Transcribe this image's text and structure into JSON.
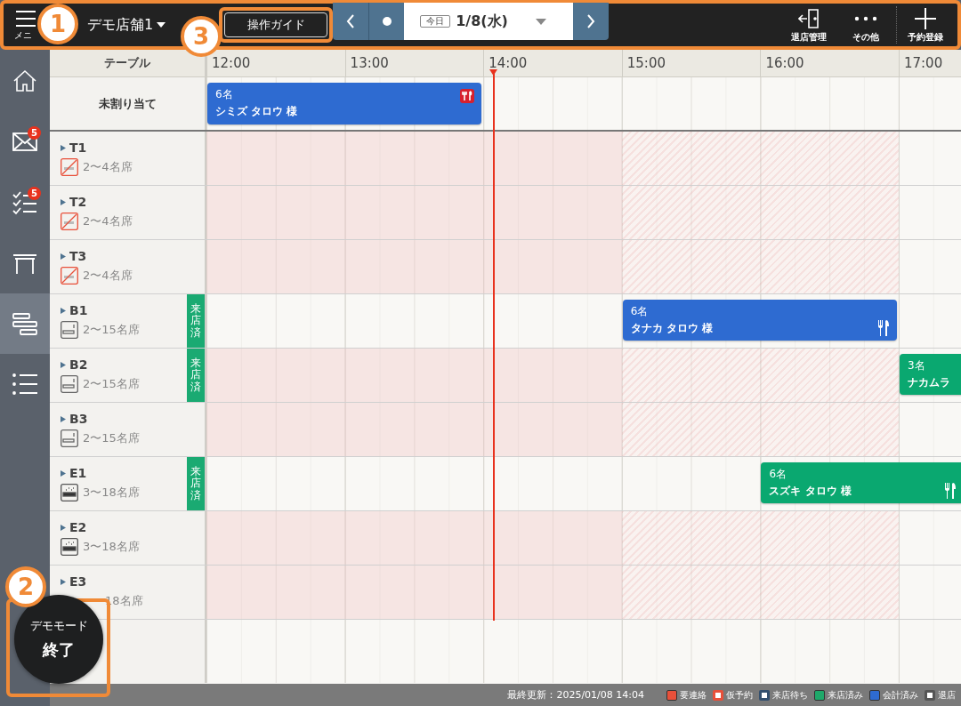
{
  "header": {
    "menu_label": "メニ",
    "store": "デモ店舗1",
    "guide_button": "操作ガイド",
    "date": {
      "today_badge": "今日",
      "value": "1/8(水)"
    },
    "actions": [
      {
        "kind": "exit",
        "label": "退店管理"
      },
      {
        "kind": "more",
        "label": "その他"
      },
      {
        "kind": "add",
        "label": "予約登録"
      }
    ]
  },
  "sidebar": {
    "items": [
      {
        "kind": "home",
        "selected": false
      },
      {
        "kind": "mail",
        "selected": false,
        "badge": "5"
      },
      {
        "kind": "tasks",
        "selected": false,
        "badge": "5"
      },
      {
        "kind": "table",
        "selected": false
      },
      {
        "kind": "timeline",
        "selected": true
      },
      {
        "kind": "list",
        "selected": false
      }
    ]
  },
  "timeline": {
    "column_header": "テーブル",
    "hours": [
      "12:00",
      "13:00",
      "14:00",
      "15:00",
      "16:00",
      "17:00"
    ],
    "unassigned": {
      "label": "未割り当て",
      "reservations": [
        {
          "kind": "alert",
          "guests": "6名",
          "name": "シミズ タロウ 様",
          "color": "#2e6bd1"
        }
      ]
    },
    "tables": [
      {
        "name": "T1",
        "seats": "2〜4名席",
        "kind": "no_smoking",
        "shaded": true
      },
      {
        "name": "T2",
        "seats": "2〜4名席",
        "kind": "no_smoking",
        "shaded": true
      },
      {
        "name": "T3",
        "seats": "2〜4名席",
        "kind": "no_smoking",
        "shaded": true
      },
      {
        "name": "B1",
        "seats": "2〜15名席",
        "kind": "smoking",
        "shaded": false,
        "tag": "来店済",
        "reservations": [
          {
            "kind": "meal",
            "guests": "6名",
            "name": "タナカ タロウ 様",
            "color": "#2e6bd1"
          }
        ]
      },
      {
        "name": "B2",
        "seats": "2〜15名席",
        "kind": "smoking",
        "shaded": true,
        "tag": "来店済",
        "reservations": [
          {
            "kind": "plain",
            "guests": "3名",
            "name": "ナカムラ",
            "color": "#0aa870"
          }
        ]
      },
      {
        "name": "B3",
        "seats": "2〜15名席",
        "kind": "smoking",
        "shaded": true
      },
      {
        "name": "E1",
        "seats": "3〜18名席",
        "kind": "heated",
        "shaded": false,
        "tag": "来店済",
        "reservations": [
          {
            "kind": "meal",
            "guests": "6名",
            "name": "スズキ タロウ 様",
            "color": "#0aa870"
          }
        ]
      },
      {
        "name": "E2",
        "seats": "3〜18名席",
        "kind": "heated",
        "shaded": true
      },
      {
        "name": "E3",
        "seats": "18名席",
        "kind": "covered",
        "shaded": true
      }
    ]
  },
  "demo_button": {
    "line_1": "デモモード",
    "line_2": "終了"
  },
  "status_bar": {
    "updated": "最終更新：2025/01/08 14:04",
    "legend": [
      {
        "kind": "filled",
        "label": "要連絡",
        "color": "#e8503a"
      },
      {
        "kind": "outlined",
        "label": "仮予約",
        "color": "#e8503a"
      },
      {
        "kind": "outlined",
        "label": "来店待ち",
        "color": "#34506e"
      },
      {
        "kind": "filled",
        "label": "来店済み",
        "color": "#1fa86a"
      },
      {
        "kind": "filled",
        "label": "会計済み",
        "color": "#2e6bd1"
      },
      {
        "kind": "outlined",
        "label": "退店",
        "color": "#555555"
      }
    ]
  },
  "annotations": [
    {
      "number": "1"
    },
    {
      "number": "2"
    },
    {
      "number": "3"
    }
  ]
}
